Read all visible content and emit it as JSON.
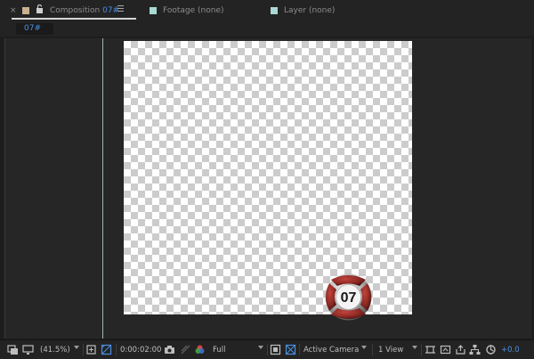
{
  "tabs": {
    "composition_prefix": "Composition",
    "composition_name": "07#",
    "footage": "Footage (none)",
    "layer": "Layer (none)"
  },
  "subtab": {
    "comp_name": "07#"
  },
  "canvas": {
    "ball_number": "07"
  },
  "toolbar": {
    "zoom": "(41.5%)",
    "timecode": "0:00:02:00",
    "resolution": "Full",
    "camera": "Active Camera",
    "views": "1 View",
    "exposure": "+0.0"
  },
  "colors": {
    "accent": "#4a8fe0",
    "tab_swatch_comp": "#c9b08e",
    "tab_swatch_view": "#a9d8d5",
    "ball_red": "#8f2a25"
  },
  "icons": [
    "close-icon",
    "lock-icon",
    "panel-menu-icon",
    "always-preview-icon",
    "monitor-icon",
    "region-icon",
    "transparency-grid-icon",
    "snapshot-icon",
    "show-snapshot-icon",
    "color-channels-icon",
    "fast-preview-icon",
    "grid-toggle-icon",
    "draft-3d-icon",
    "flowchart-icon",
    "reset-exposure-icon"
  ]
}
